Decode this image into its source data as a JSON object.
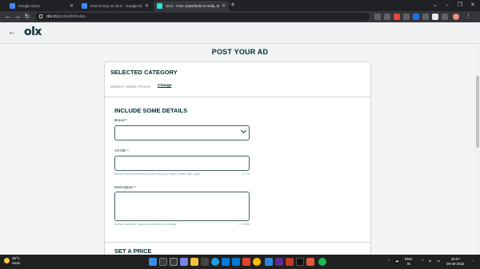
{
  "browser": {
    "tabs": [
      {
        "title": "Google Docs",
        "favicon_color": "#4285f4",
        "active": false
      },
      {
        "title": "How to buy on OLX - Google Do...",
        "favicon_color": "#4285f4",
        "active": false
      },
      {
        "title": "OLX - Free classifieds in India, Bu...",
        "favicon_color": "#23e5db",
        "active": true
      }
    ],
    "new_tab": "+",
    "address": {
      "domain": "olx.in",
      "path": "/post/attributes"
    }
  },
  "header": {
    "back_icon": "←",
    "logo": "olx"
  },
  "page": {
    "title": "POST YOUR AD",
    "selected_category": {
      "heading": "SELECTED CATEGORY",
      "breadcrumb": "Mobiles / Mobile Phones",
      "change_link": "Change"
    },
    "details": {
      "heading": "INCLUDE SOME DETAILS",
      "brand_label": "Brand *",
      "brand_value": "",
      "ad_title_label": "Ad title *",
      "ad_title_value": "",
      "ad_title_help": "Mention the key features of your item (e.g. brand, model, age, type)",
      "ad_title_count": "0 / 70",
      "description_label": "Description *",
      "description_value": "",
      "description_help": "Include condition, features and reason for selling",
      "description_count": "0 / 4096"
    },
    "price": {
      "heading": "SET A PRICE"
    }
  },
  "taskbar": {
    "temperature": "45°C",
    "weather": "Haze",
    "language": "ENG",
    "region": "IN",
    "time": "18:07",
    "date": "09-09-2022"
  }
}
